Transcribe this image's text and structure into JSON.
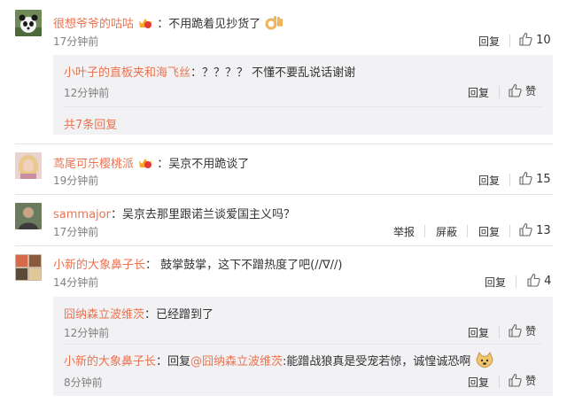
{
  "comments": [
    {
      "avatar": "panda-avatar",
      "username": "很想爷爷的咕咕",
      "text": "：不用跪着见抄货了",
      "time": "17分钟前",
      "reply_label": "回复",
      "likes": "10",
      "replies": [
        {
          "username": "小叶子的直板夹和海飞丝",
          "text": "：？？？？ 不懂不要乱说话谢谢",
          "time": "12分钟前",
          "reply_label": "回复",
          "likes": "赞"
        }
      ],
      "more_replies": "共7条回复"
    },
    {
      "avatar": "blonde-avatar",
      "username": "茑尾可乐樱桃派",
      "text": "：吴京不用跪谈了",
      "time": "19分钟前",
      "reply_label": "回复",
      "likes": "15"
    },
    {
      "avatar": "person-avatar",
      "username": "sammajor",
      "text": "：吴京去那里跟诺兰谈爱国主义吗？",
      "time": "17分钟前",
      "report_label": "举报",
      "block_label": "屏蔽",
      "reply_label": "回复",
      "likes": "13"
    },
    {
      "avatar": "group-avatar",
      "username": "小新的大象鼻子长",
      "text": "： 鼓掌鼓掌，这下不蹭热度了吧(//∇//)",
      "time": "14分钟前",
      "reply_label": "回复",
      "likes": "4",
      "replies": [
        {
          "username": "囧纳森立波维茨",
          "text": "：已经蹭到了",
          "time": "12分钟前",
          "reply_label": "回复",
          "likes": "赞"
        },
        {
          "username": "小新的大象鼻子长",
          "text": "：回复",
          "mention": "@囧纳森立波维茨",
          "text2": ":能蹭战狼真是受宠若惊，诚惶诚恐啊",
          "time": "8分钟前",
          "reply_label": "回复",
          "likes": "赞"
        }
      ]
    }
  ],
  "colors": {
    "username": "#eb7350",
    "reply_box": "#f2f2f5",
    "time": "#808080"
  }
}
